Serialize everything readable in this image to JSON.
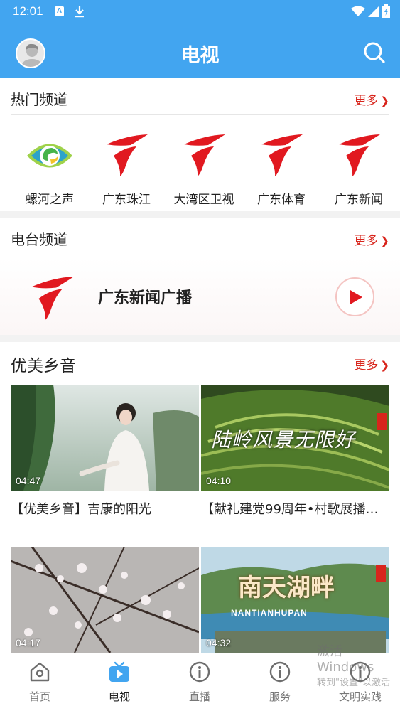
{
  "status_bar": {
    "time": "12:01",
    "a_icon_label": "A"
  },
  "header": {
    "title": "电视"
  },
  "hot_channels": {
    "title": "热门频道",
    "more": "更多",
    "items": [
      {
        "name": "螺河之声",
        "logo": "luohe-eye-logo"
      },
      {
        "name": "广东珠江",
        "logo": "guangdong-tv-logo"
      },
      {
        "name": "大湾区卫视",
        "logo": "guangdong-tv-logo"
      },
      {
        "name": "广东体育",
        "logo": "guangdong-tv-logo"
      },
      {
        "name": "广东新闻",
        "logo": "guangdong-tv-logo"
      }
    ]
  },
  "radio": {
    "title": "电台频道",
    "more": "更多",
    "item": {
      "name": "广东新闻广播",
      "logo": "guangdong-tv-logo"
    }
  },
  "videos": {
    "title": "优美乡音",
    "more": "更多",
    "items": [
      {
        "duration": "04:47",
        "title": "【优美乡音】吉康的阳光"
      },
      {
        "duration": "04:10",
        "title": "【献礼建党99周年•村歌展播】…",
        "overlay": "陆岭风景无限好"
      },
      {
        "duration": "04:17",
        "title": ""
      },
      {
        "duration": "04:32",
        "title": "",
        "overlay": "南天湖畔",
        "overlay_sub": "NANTIANHUPAN"
      }
    ]
  },
  "bottom_nav": [
    {
      "label": "首页",
      "icon": "home-icon",
      "active": false
    },
    {
      "label": "电视",
      "icon": "tv-icon",
      "active": true
    },
    {
      "label": "直播",
      "icon": "info-circle-icon",
      "active": false
    },
    {
      "label": "服务",
      "icon": "info-circle-icon",
      "active": false
    },
    {
      "label": "文明实践",
      "icon": "info-circle-icon",
      "active": false
    }
  ],
  "watermark": {
    "line1": "激活 Windows",
    "line2": "转到\"设置\"以激活"
  },
  "colors": {
    "primary": "#42a5f0",
    "accent": "#d8251c",
    "nav_active": "#42a5f0"
  }
}
